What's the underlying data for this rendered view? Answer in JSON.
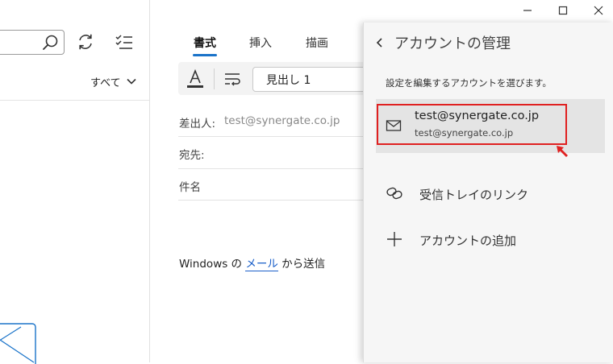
{
  "left_pane": {
    "filter_label": "すべて"
  },
  "compose": {
    "tabs": [
      "書式",
      "挿入",
      "描画"
    ],
    "style_value": "見出し 1",
    "from_label": "差出人:",
    "from_value": "test@synergate.co.jp",
    "to_label": "宛先:",
    "subject_label": "件名",
    "signature_prefix": "Windows の ",
    "signature_link": "メール",
    "signature_suffix": " から送信"
  },
  "account_panel": {
    "title": "アカウントの管理",
    "hint": "設定を編集するアカウントを選びます。",
    "account": {
      "email": "test@synergate.co.jp",
      "sub": "test@synergate.co.jp"
    },
    "link_inbox_label": "受信トレイのリンク",
    "add_account_label": "アカウントの追加"
  },
  "colors": {
    "accent": "#1a73c9",
    "highlight": "#e02020"
  }
}
